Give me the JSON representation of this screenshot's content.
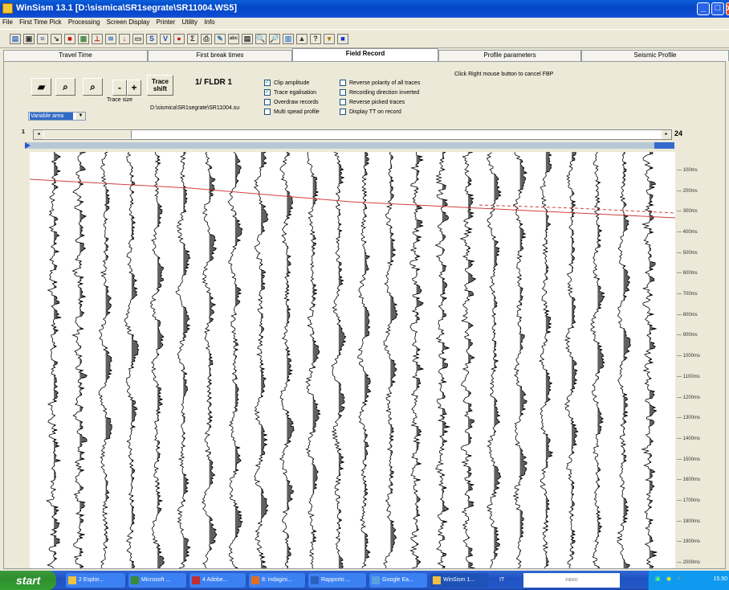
{
  "window": {
    "title": "WinSism 13.1  [D:\\sismica\\SR1segrate\\SR11004.WS5]",
    "min_glyph": "_",
    "max_glyph": "□",
    "close_glyph": "x"
  },
  "menu": [
    "File",
    "First Time Pick",
    "Processing",
    "Screen Display",
    "Printer",
    "Utility",
    "Info"
  ],
  "toolbar": {
    "icons": [
      "open-icon",
      "save-icon",
      "chart-icon",
      "pick-icon",
      "red-square-icon",
      "image-icon",
      "marker-icon",
      "chart2-icon",
      "down-arrow-icon",
      "rect-icon",
      "s-icon",
      "v-icon",
      "red-dot-icon",
      "sigma-icon",
      "print-icon",
      "paint-icon",
      "abc-icon",
      "print-label-icon",
      "zoom-icon",
      "zoom2-icon",
      "grid-icon",
      "person-icon",
      "help-icon",
      "filter-icon",
      "blue-square-icon"
    ],
    "glyphs": [
      "▤",
      "▣",
      "≈",
      "↘",
      "■",
      "▦",
      "⊥",
      "≋",
      "↓",
      "▭",
      "S",
      "V",
      "●",
      "Σ",
      "⎙",
      "✎",
      "abc",
      "▤",
      "🔍",
      "🔎",
      "▥",
      "▲",
      "?",
      "▾",
      "■"
    ]
  },
  "tabs": [
    "Travel Time",
    "First break times",
    "Field Record",
    "Profile parameters",
    "Seismic Profile"
  ],
  "active_tab": "Field Record",
  "panel": {
    "trace_size_label": "Trace size",
    "trace_shift_label": "Trace\nshift",
    "minus_label": "-",
    "plus_label": "+",
    "record_label": "1/ FLDR  1",
    "file_path": "D:\\sismica\\SR1segrate\\SR11004.su",
    "display_mode": "Variable area",
    "hint": "Click Right mouse button to  cancel FBP",
    "trace_start": "1",
    "trace_end": "24"
  },
  "options_left": [
    {
      "label": "Clip amplitude",
      "checked": true
    },
    {
      "label": "Trace egalisation",
      "checked": true
    },
    {
      "label": "Overdraw records",
      "checked": false
    },
    {
      "label": "Multi spead profile",
      "checked": false
    }
  ],
  "options_right": [
    {
      "label": "Reverse polarity of all traces",
      "checked": false
    },
    {
      "label": "Recording direction inverted",
      "checked": false
    },
    {
      "label": "Reverse picked traces",
      "checked": false
    },
    {
      "label": "Display TT on record",
      "checked": false
    }
  ],
  "time_axis": [
    "100ms",
    "200ms",
    "300ms",
    "400ms",
    "500ms",
    "600ms",
    "700ms",
    "800ms",
    "900ms",
    "1000ms",
    "1100ms",
    "1200ms",
    "1300ms",
    "1400ms",
    "1500ms",
    "1600ms",
    "1700ms",
    "1800ms",
    "1900ms",
    "2000ms"
  ],
  "traces": {
    "count": 24,
    "pick_color": "#d04040",
    "trace_color": "#000000"
  },
  "taskbar": {
    "start": "start",
    "tasks": [
      "2 Esplor...",
      "Microsoft ...",
      "4 Adobe...",
      "8: indagini...",
      "Rapporto ...",
      "Google Ea...",
      "WinSism 1..."
    ],
    "tray_label": "IT",
    "ad_text": "FIERO",
    "clock": "15.50"
  }
}
